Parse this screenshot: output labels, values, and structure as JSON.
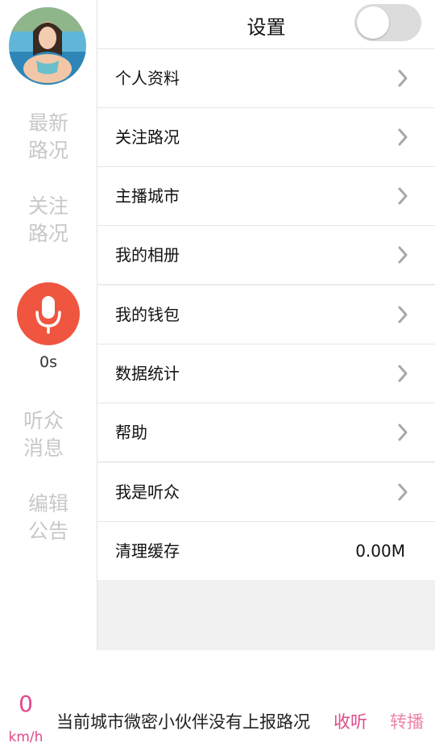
{
  "sidebar": {
    "items": [
      {
        "line1": "最新",
        "line2": "路况"
      },
      {
        "line1": "关注",
        "line2": "路况"
      },
      {
        "line1": "听众",
        "line2": "消息"
      },
      {
        "line1": "编辑",
        "line2": "公告"
      }
    ],
    "timer": "0s",
    "mic_color": "#ef553f"
  },
  "header": {
    "title": "设置",
    "toggle_state": "off"
  },
  "settings": {
    "rows": [
      {
        "label": "个人资料"
      },
      {
        "label": "关注路况"
      },
      {
        "label": "主播城市"
      },
      {
        "label": "我的相册"
      },
      {
        "label": "我的钱包"
      },
      {
        "label": "数据统计"
      },
      {
        "label": "帮助"
      },
      {
        "label": "我是听众"
      }
    ],
    "cache": {
      "label": "清理缓存",
      "value": "0.00M"
    }
  },
  "bottom_bar": {
    "speed": "0",
    "speed_unit": "km/h",
    "status": "当前城市微密小伙伴没有上报路况",
    "listen": "收听",
    "relay": "转播",
    "accent": "#e04a8a"
  }
}
